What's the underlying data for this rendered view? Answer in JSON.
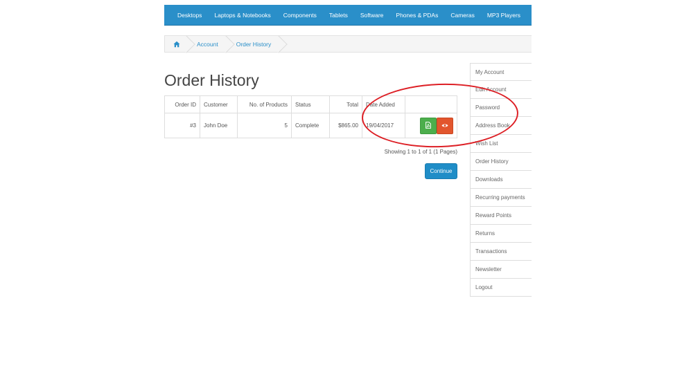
{
  "nav": {
    "items": [
      "Desktops",
      "Laptops & Notebooks",
      "Components",
      "Tablets",
      "Software",
      "Phones & PDAs",
      "Cameras",
      "MP3 Players"
    ]
  },
  "breadcrumb": {
    "home_icon": "home-icon",
    "items": [
      "Account",
      "Order History"
    ]
  },
  "page": {
    "title": "Order History"
  },
  "table": {
    "headers": [
      "Order ID",
      "Customer",
      "No. of Products",
      "Status",
      "Total",
      "Date Added",
      ""
    ],
    "rows": [
      {
        "order_id": "#3",
        "customer": "John Doe",
        "products": "5",
        "status": "Complete",
        "total": "$865.00",
        "date_added": "19/04/2017"
      }
    ],
    "action_icons": [
      "pdf-file-icon",
      "eye-icon"
    ]
  },
  "pagination": {
    "text": "Showing 1 to 1 of 1 (1 Pages)"
  },
  "buttons": {
    "continue_label": "Continue"
  },
  "sidebar": {
    "items": [
      "My Account",
      "Edit Account",
      "Password",
      "Address Book",
      "Wish List",
      "Order History",
      "Downloads",
      "Recurring payments",
      "Reward Points",
      "Returns",
      "Transactions",
      "Newsletter",
      "Logout"
    ]
  },
  "colors": {
    "nav_bg": "#2a8fc9",
    "link": "#2a8fc9",
    "pdf_button": "#4cae4c",
    "view_button": "#e2552d",
    "continue_button": "#1f8dc7",
    "annotation": "#dd1f25"
  }
}
